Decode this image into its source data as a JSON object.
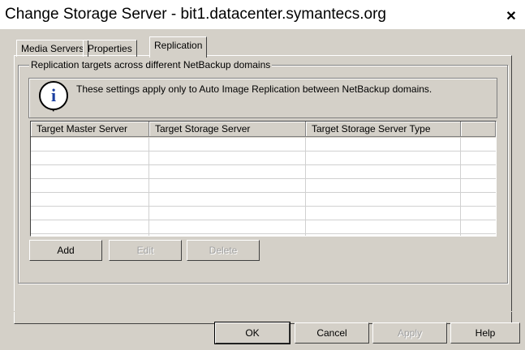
{
  "window": {
    "title": "Change Storage Server  -  bit1.datacenter.symantecs.org",
    "close_glyph": "✕"
  },
  "tabs": [
    {
      "label": "Media Servers",
      "active": false
    },
    {
      "label": "Properties",
      "active": false
    },
    {
      "label": "Replication",
      "active": true
    }
  ],
  "replication": {
    "group_label": "Replication targets across different NetBackup domains",
    "info_icon": "info-icon",
    "info_text": "These settings apply only to Auto Image Replication between NetBackup domains.",
    "table": {
      "columns": [
        "Target Master Server",
        "Target Storage Server",
        "Target Storage Server Type",
        ""
      ],
      "rows": []
    },
    "buttons": {
      "add": "Add",
      "edit": "Edit",
      "delete": "Delete"
    }
  },
  "dialog_buttons": {
    "ok": "OK",
    "cancel": "Cancel",
    "apply": "Apply",
    "help": "Help"
  }
}
